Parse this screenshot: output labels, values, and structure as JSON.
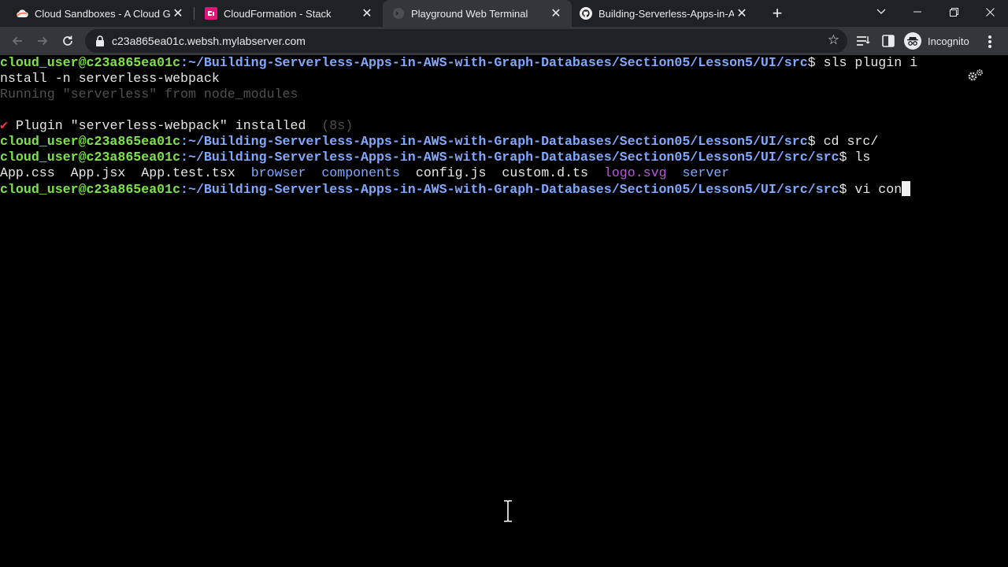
{
  "tabs": [
    {
      "title": "Cloud Sandboxes - A Cloud Guru",
      "favicon": "cloud-icon",
      "active": false
    },
    {
      "title": "CloudFormation - Stack",
      "favicon": "cloudformation-icon",
      "active": false
    },
    {
      "title": "Playground Web Terminal",
      "favicon": "terminal-icon",
      "active": true
    },
    {
      "title": "Building-Serverless-Apps-in-AWS",
      "favicon": "github-icon",
      "active": false
    }
  ],
  "toolbar": {
    "url": "c23a865ea01c.websh.mylabserver.com",
    "profile_label": "Incognito"
  },
  "terminal": {
    "prompt_user": "cloud_user@c23a865ea01c",
    "path_src": ":~/Building-Serverless-Apps-in-AWS-with-Graph-Databases/Section05/Lesson5/UI/src",
    "path_srcsrc": ":~/Building-Serverless-Apps-in-AWS-with-Graph-Databases/Section05/Lesson5/UI/src/src",
    "line1_cmd": "$ sls plugin i",
    "line2": "nstall -n serverless-webpack",
    "line3": "Running \"serverless\" from node_modules",
    "check_mark": "✔",
    "line5": " Plugin \"serverless-webpack\" installed",
    "line5_time": "  (8s)",
    "line6_cmd": "$ cd src/",
    "line7_cmd": "$ ls",
    "ls_files": {
      "f1": "App.css",
      "f2": "App.jsx",
      "f3": "App.test.tsx",
      "d1": "browser",
      "d2": "components",
      "f4": "config.js",
      "f5": "custom.d.ts",
      "f6": "logo.svg",
      "d3": "server"
    },
    "line9_cmd": "$ vi con"
  },
  "colors": {
    "prompt_green": "#7de34a",
    "path_blue": "#7fa8ff",
    "svg_magenta": "#b55ad7"
  }
}
